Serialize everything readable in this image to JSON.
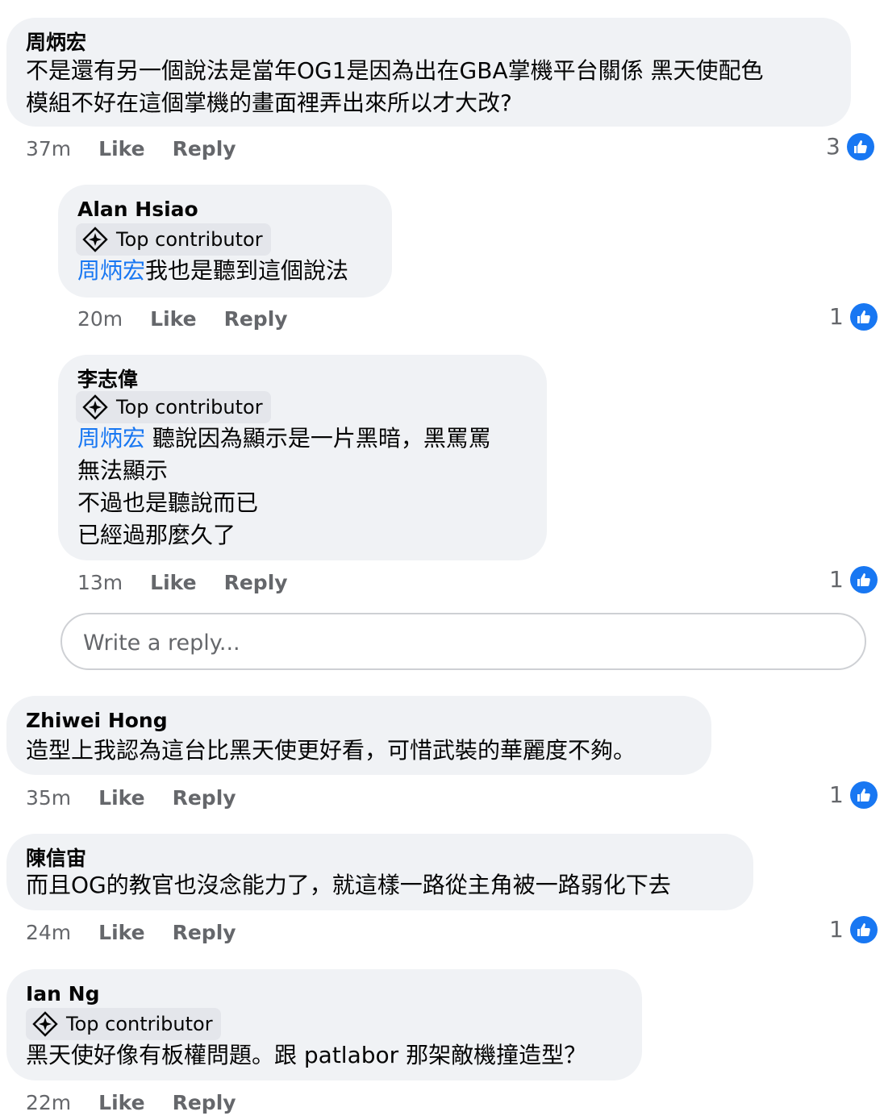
{
  "comments": [
    {
      "author": "周炳宏",
      "lines": [
        "不是還有另一個說法是當年OG1是因為出在GBA掌機平台關係 黑天使配色",
        "模組不好在這個掌機的畫面裡弄出來所以才大改?"
      ],
      "time": "37m",
      "like": "Like",
      "reply": "Reply",
      "likes": "3"
    },
    {
      "author": "Alan Hsiao",
      "badge": "Top contributor",
      "mention": "周炳宏",
      "line1_rest": "我也是聽到這個說法",
      "time": "20m",
      "like": "Like",
      "reply": "Reply",
      "likes": "1"
    },
    {
      "author": "李志偉",
      "badge": "Top contributor",
      "mention": "周炳宏",
      "line1_rest": " 聽說因為顯示是一片黑暗，黑罵罵",
      "lines": [
        "無法顯示",
        "不過也是聽說而已",
        "已經過那麼久了"
      ],
      "time": "13m",
      "like": "Like",
      "reply": "Reply",
      "likes": "1"
    },
    {
      "author": "Zhiwei Hong",
      "lines": [
        "造型上我認為這台比黑天使更好看，可惜武裝的華麗度不夠。"
      ],
      "time": "35m",
      "like": "Like",
      "reply": "Reply",
      "likes": "1"
    },
    {
      "author": "陳信宙",
      "lines": [
        "而且OG的教官也沒念能力了，就這樣一路從主角被一路弱化下去"
      ],
      "time": "24m",
      "like": "Like",
      "reply": "Reply",
      "likes": "1"
    },
    {
      "author": "Ian Ng",
      "badge": "Top contributor",
      "lines": [
        "黑天使好像有板權問題。跟 patlabor 那架敵機撞造型？"
      ],
      "time": "22m",
      "like": "Like",
      "reply": "Reply"
    }
  ],
  "reply_box": {
    "placeholder": "Write a reply..."
  },
  "colors": {
    "accent": "#1877f2",
    "bubble": "#f0f2f5",
    "meta": "#65676b"
  },
  "icons": {
    "badge": "top-contributor-icon",
    "like": "thumbs-up-icon"
  }
}
